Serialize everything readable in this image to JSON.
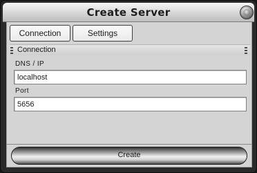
{
  "window": {
    "title": "Create Server"
  },
  "tabs": [
    {
      "label": "Connection"
    },
    {
      "label": "Settings"
    }
  ],
  "section": {
    "title": "Connection"
  },
  "fields": {
    "dns": {
      "label": "DNS / IP",
      "value": "localhost"
    },
    "port": {
      "label": "Port",
      "value": "5656"
    }
  },
  "footer": {
    "create_label": "Create"
  }
}
